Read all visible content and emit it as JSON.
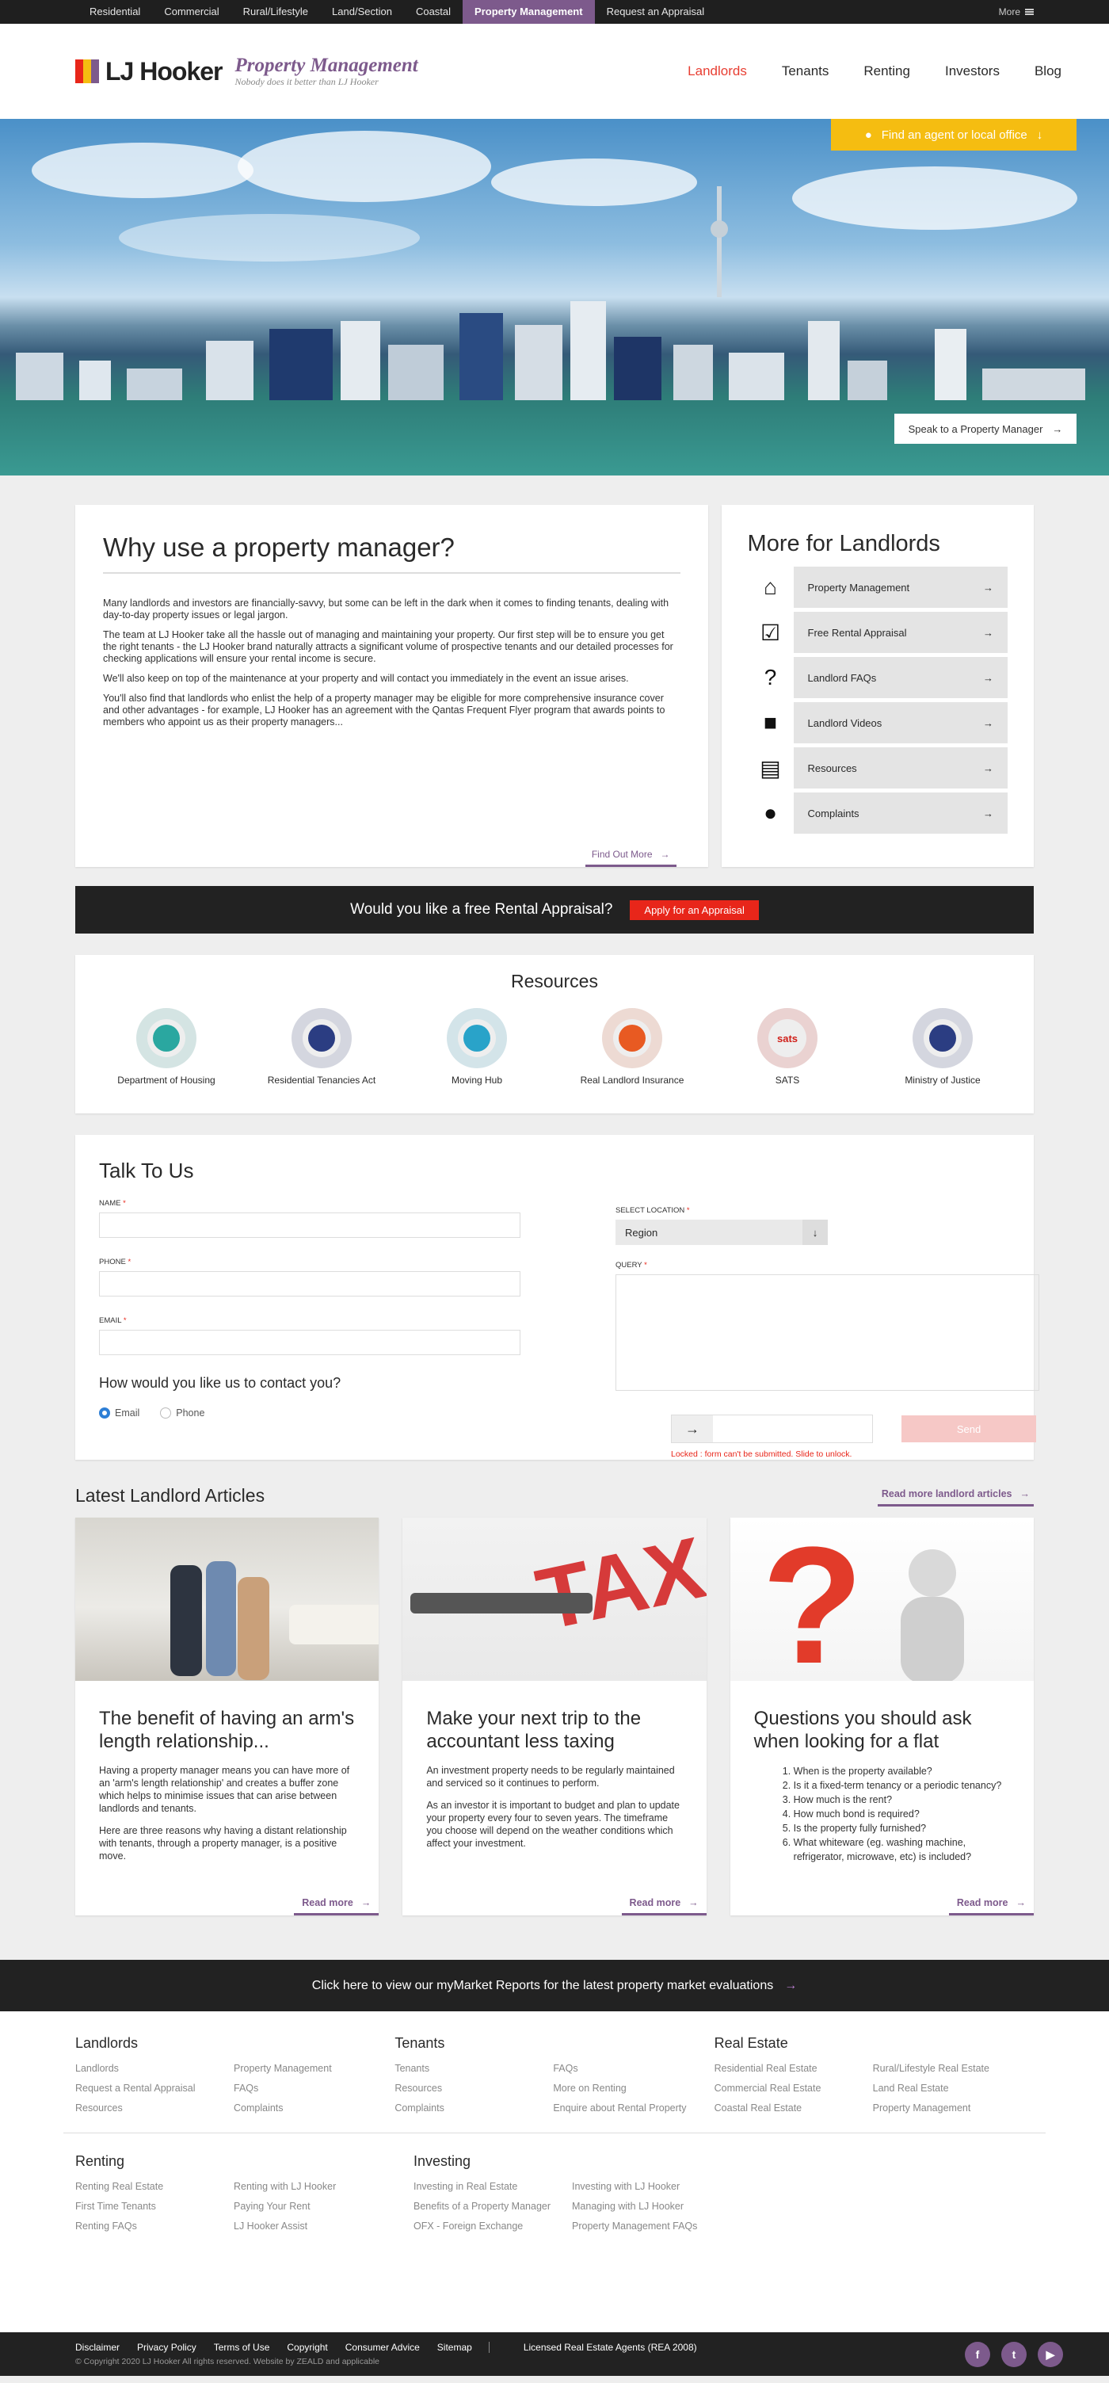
{
  "topbar": {
    "links": [
      "Residential",
      "Commercial",
      "Rural/Lifestyle",
      "Land/Section",
      "Coastal",
      "Property Management",
      "Request an Appraisal"
    ],
    "active": "Property Management",
    "more": "More"
  },
  "header": {
    "logo": "LJ Hooker",
    "brand_title": "Property Management",
    "brand_sub": "Nobody does it better than LJ Hooker",
    "nav": [
      "Landlords",
      "Tenants",
      "Renting",
      "Investors",
      "Blog"
    ],
    "nav_active": "Landlords"
  },
  "hero": {
    "find_agent": "Find an agent or local office",
    "speak": "Speak to a Property Manager"
  },
  "why": {
    "title": "Why use a property manager?",
    "paragraphs": [
      "Many landlords and investors are financially-savvy, but some can be left in the dark when it comes to finding tenants, dealing with day-to-day property issues or legal jargon.",
      "The team at LJ Hooker take all the hassle out of managing and maintaining your property. Our first step will be to ensure you get the right tenants - the LJ Hooker brand naturally attracts a significant volume of prospective tenants and our detailed processes for checking applications will ensure your rental income is secure.",
      "We'll also keep on top of the maintenance at your property and will contact you immediately in the event an issue arises.",
      "You'll also find that landlords who enlist the help of a property manager may be eligible for more comprehensive insurance cover and other advantages - for example, LJ Hooker has an agreement with the Qantas Frequent Flyer program that awards points to members who appoint us as their property managers..."
    ],
    "find_out_more": "Find Out More"
  },
  "more_landlords": {
    "title": "More for Landlords",
    "items": [
      {
        "label": "Property Management",
        "icon": "home-icon"
      },
      {
        "label": "Free Rental Appraisal",
        "icon": "checkbox-icon"
      },
      {
        "label": "Landlord FAQs",
        "icon": "question-icon"
      },
      {
        "label": "Landlord Videos",
        "icon": "video-icon"
      },
      {
        "label": "Resources",
        "icon": "document-icon"
      },
      {
        "label": "Complaints",
        "icon": "user-icon"
      }
    ]
  },
  "appraisal_band": {
    "text": "Would you like a free Rental Appraisal?",
    "button": "Apply for an Appraisal"
  },
  "resources": {
    "title": "Resources",
    "items": [
      {
        "label": "Department of Housing",
        "logo_color": "#2aa7a0"
      },
      {
        "label": "Residential Tenancies Act",
        "logo_color": "#2b3d82"
      },
      {
        "label": "Moving Hub",
        "logo_color": "#29a3c9"
      },
      {
        "label": "Real Landlord Insurance",
        "logo_color": "#e85a22"
      },
      {
        "label": "SATS",
        "logo_color": "#d0201a",
        "logo_text": "sats"
      },
      {
        "label": "Ministry of Justice",
        "logo_color": "#2b3d82"
      }
    ]
  },
  "talk": {
    "title": "Talk To Us",
    "name_label": "NAME",
    "phone_label": "PHONE",
    "email_label": "EMAIL",
    "contact_question": "How would you like us to contact you?",
    "options": [
      "Email",
      "Phone"
    ],
    "location_label": "SELECT LOCATION",
    "location_value": "Region",
    "query_label": "QUERY",
    "send": "Send",
    "locked": "Locked : form can't be submitted. Slide to unlock."
  },
  "articles": {
    "title": "Latest Landlord Articles",
    "read_all": "Read more landlord articles",
    "read_more": "Read more",
    "items": [
      {
        "title": "The benefit of having an arm's length relationship...",
        "paragraphs": [
          "Having a property manager means you can have more of an 'arm's length relationship' and creates a buffer zone which helps to minimise issues that can arise between landlords and tenants.",
          "Here are three reasons why having a distant relationship with tenants, through a property manager, is a positive move."
        ]
      },
      {
        "title": "Make your next trip to the accountant less taxing",
        "paragraphs": [
          "An investment property needs to be regularly maintained and serviced so it continues to perform.",
          "As an investor it is important to budget and plan to update your property every four to seven years. The timeframe you choose will depend on the weather conditions which affect your investment."
        ]
      },
      {
        "title": "Questions you should ask when looking for a flat",
        "list": [
          "When is the property available?",
          "Is it a fixed-term tenancy or a periodic tenancy?",
          "How much is the rent?",
          "How much bond is required?",
          "Is the property fully furnished?",
          "What whiteware (eg. washing machine, refrigerator, microwave, etc) is included?"
        ]
      }
    ]
  },
  "market_band": "Click here to view our myMarket Reports for the latest property market evaluations",
  "footer": {
    "sections_top": [
      {
        "title": "Landlords",
        "links": [
          "Landlords",
          "Property Management",
          "Request a Rental Appraisal",
          "FAQs",
          "Resources",
          "Complaints"
        ]
      },
      {
        "title": "Tenants",
        "links": [
          "Tenants",
          "FAQs",
          "Resources",
          "More on Renting",
          "Complaints",
          "Enquire about Rental Property"
        ]
      },
      {
        "title": "Real Estate",
        "links": [
          "Residential Real Estate",
          "Rural/Lifestyle Real Estate",
          "Commercial Real Estate",
          "Land Real Estate",
          "Coastal Real Estate",
          "Property Management"
        ]
      }
    ],
    "sections_bottom": [
      {
        "title": "Renting",
        "links": [
          "Renting Real Estate",
          "Renting with LJ Hooker",
          "First Time Tenants",
          "Paying Your Rent",
          "Renting FAQs",
          "LJ Hooker Assist"
        ]
      },
      {
        "title": "Investing",
        "links": [
          "Investing in Real Estate",
          "Investing with LJ Hooker",
          "Benefits of a Property Manager",
          "Managing with LJ Hooker",
          "OFX - Foreign Exchange",
          "Property Management FAQs"
        ]
      }
    ]
  },
  "bottom": {
    "links": [
      "Disclaimer",
      "Privacy Policy",
      "Terms of Use",
      "Copyright",
      "Consumer Advice",
      "Sitemap"
    ],
    "licensed": "Licensed Real Estate Agents (REA 2008)",
    "copyright": "© Copyright 2020 LJ Hooker All rights reserved. Website by ZEALD and applicable"
  },
  "colors": {
    "brand_purple": "#7d5a8c",
    "accent_red": "#e8261a",
    "find_yellow": "#f5bd11",
    "dark": "#222222"
  }
}
